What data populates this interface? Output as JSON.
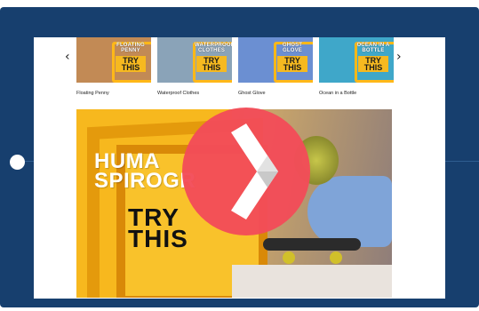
{
  "carousel": {
    "prev_arrow": "‹",
    "next_arrow": "›",
    "items": [
      {
        "tag": "FLOATING PENNY",
        "try": "TRY THIS",
        "label": "Floating Penny",
        "bg": "#c28a55"
      },
      {
        "tag": "WATERPROOF CLOTHES",
        "try": "TRY THIS",
        "label": "Waterproof Clothes",
        "bg": "#8aa3b8"
      },
      {
        "tag": "GHOST GLOVE",
        "try": "TRY THIS",
        "label": "Ghost Glove",
        "bg": "#6b8fd2"
      },
      {
        "tag": "OCEAN IN A BOTTLE",
        "try": "TRY THIS",
        "label": "Ocean in a Bottle",
        "bg": "#3fa7c9"
      }
    ]
  },
  "video": {
    "title": "HUMAN SPIROGRAPH",
    "title_visible": "HUMA\nSPIROGR",
    "subtitle": "TRY THIS",
    "play_icon": "play-icon"
  },
  "colors": {
    "tablet": "#173f6e",
    "play_button": "#f24c58",
    "brand_yellow": "#f7b81e"
  }
}
